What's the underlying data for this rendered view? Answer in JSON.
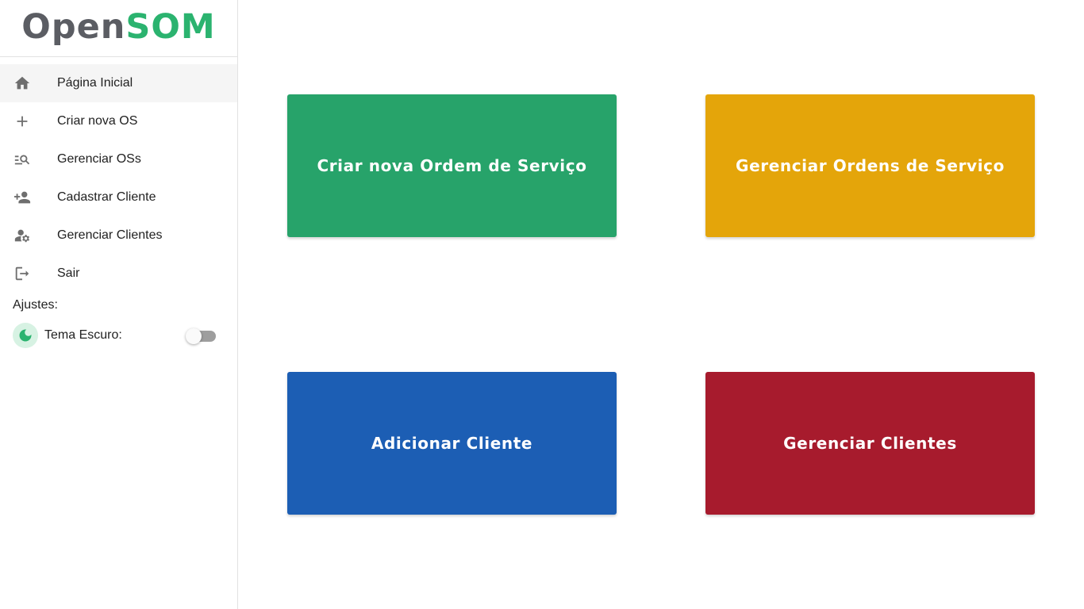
{
  "brand": {
    "part1": "Open",
    "part2": "SOM"
  },
  "sidebar": {
    "items": [
      {
        "label": "Página Inicial",
        "icon": "home-icon"
      },
      {
        "label": "Criar nova OS",
        "icon": "plus-icon"
      },
      {
        "label": "Gerenciar OSs",
        "icon": "manage-search-icon"
      },
      {
        "label": "Cadastrar Cliente",
        "icon": "person-add-icon"
      },
      {
        "label": "Gerenciar Clientes",
        "icon": "manage-accounts-icon"
      },
      {
        "label": "Sair",
        "icon": "logout-icon"
      }
    ],
    "active_index": 0
  },
  "settings": {
    "title": "Ajustes:",
    "dark_theme_label": "Tema Escuro:",
    "dark_theme_enabled": false
  },
  "cards": [
    {
      "label": "Criar nova Ordem de Serviço",
      "color": "#27a36a"
    },
    {
      "label": "Gerenciar Ordens de Serviço",
      "color": "#e4a50a"
    },
    {
      "label": "Adicionar Cliente",
      "color": "#1c5eb4"
    },
    {
      "label": "Gerenciar Clientes",
      "color": "#a71b2d"
    }
  ],
  "colors": {
    "brand_gray": "#5b5d63",
    "brand_green": "#2bb36f",
    "active_item_bg": "#f5f5f5"
  }
}
